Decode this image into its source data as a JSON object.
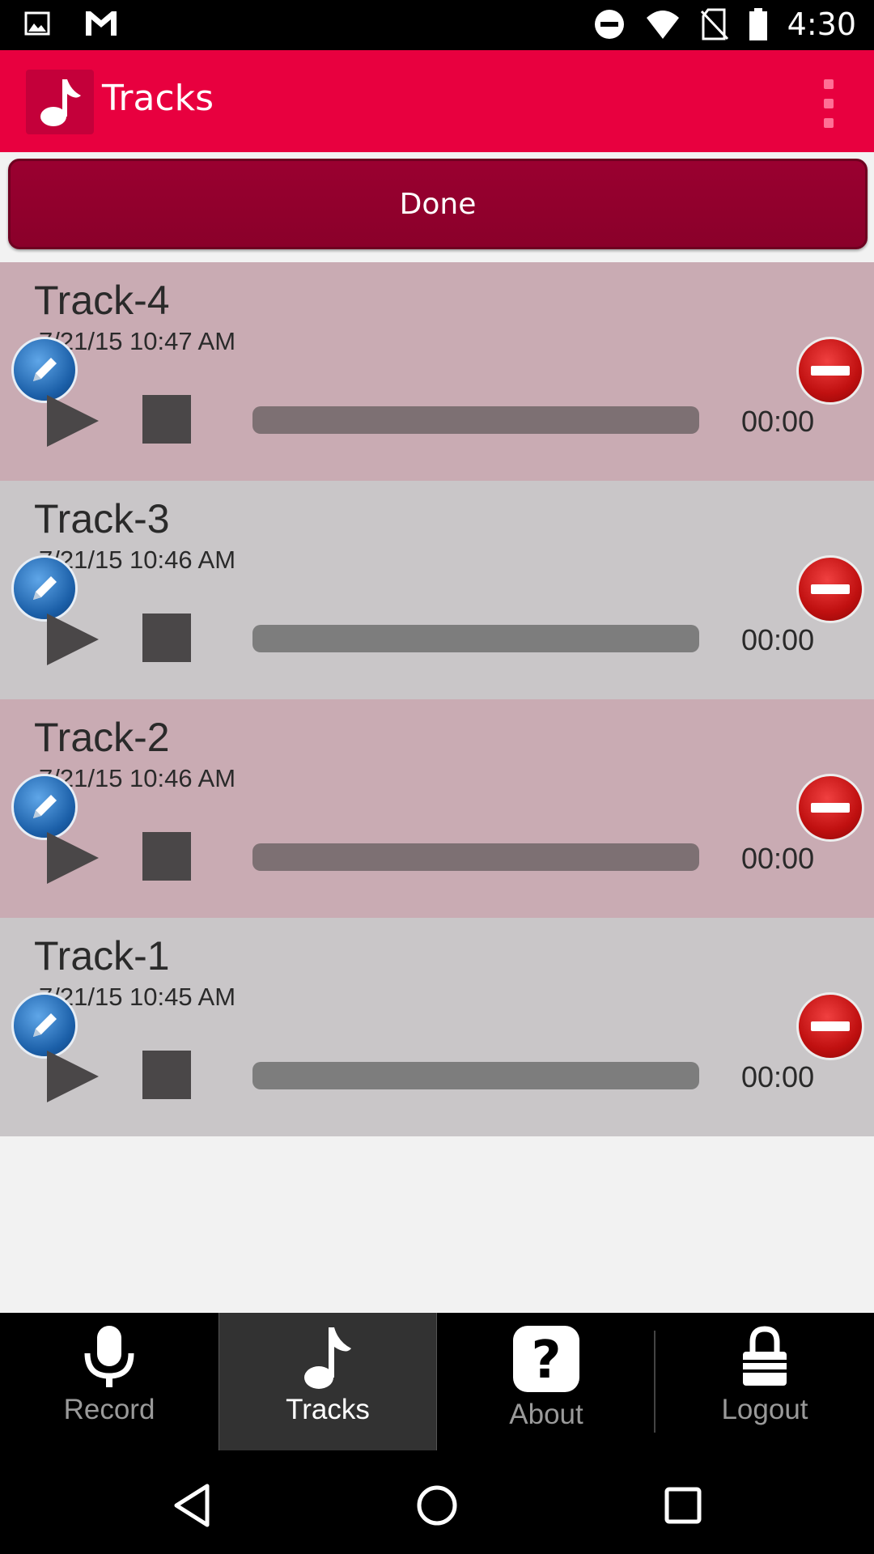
{
  "status_bar": {
    "time": "4:30",
    "left_icons": [
      "image-icon",
      "gmail-icon"
    ],
    "right_icons": [
      "do-not-disturb-icon",
      "wifi-icon",
      "no-sim-icon",
      "battery-icon"
    ]
  },
  "app_bar": {
    "title": "Tracks",
    "logo": "music-note-icon",
    "menu": "overflow-menu-icon",
    "color": "#e8003f"
  },
  "done_button": {
    "label": "Done"
  },
  "tracks": [
    {
      "title": "Track-4",
      "date": "7/21/15 10:47 AM",
      "time": "00:00",
      "progress": 0
    },
    {
      "title": "Track-3",
      "date": "7/21/15 10:46 AM",
      "time": "00:00",
      "progress": 0
    },
    {
      "title": "Track-2",
      "date": "7/21/15 10:46 AM",
      "time": "00:00",
      "progress": 0
    },
    {
      "title": "Track-1",
      "date": "7/21/15 10:45 AM",
      "time": "00:00",
      "progress": 0
    }
  ],
  "tab_bar": {
    "active": "Tracks",
    "tabs": [
      {
        "label": "Record",
        "icon": "microphone-icon"
      },
      {
        "label": "Tracks",
        "icon": "music-note-icon"
      },
      {
        "label": "About",
        "icon": "question-icon"
      },
      {
        "label": "Logout",
        "icon": "lock-icon"
      }
    ]
  },
  "nav_bar": {
    "buttons": [
      "back-icon",
      "home-icon",
      "recents-icon"
    ]
  }
}
